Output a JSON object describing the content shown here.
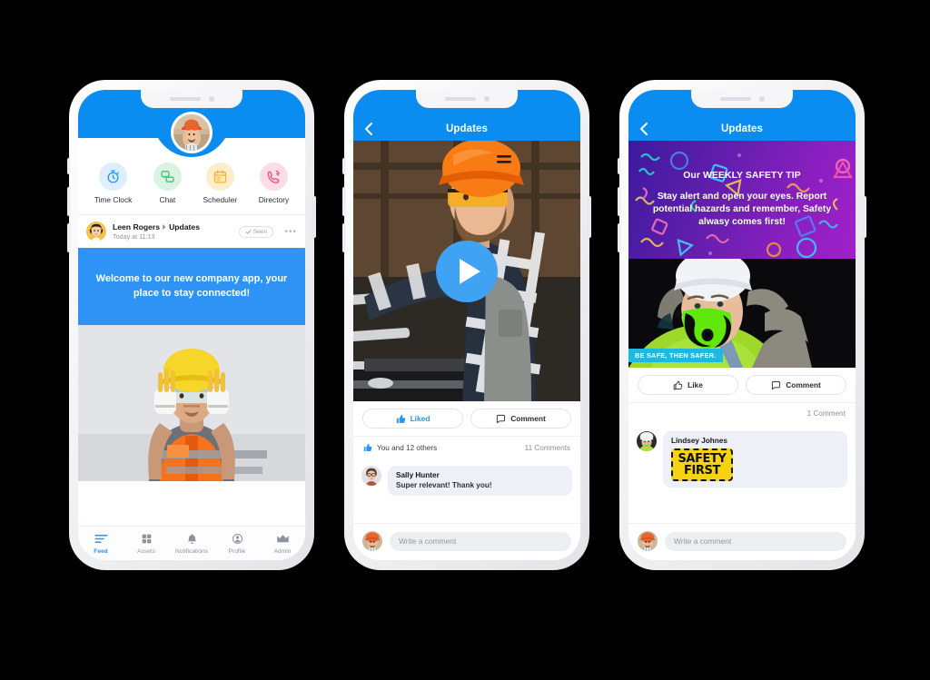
{
  "brand": {
    "blue": "#0a8cf0",
    "banner_blue": "#2f93f5",
    "liked_blue": "#2b95f6"
  },
  "phone1": {
    "header": {
      "avatar_alt": "worker-orange-helmet"
    },
    "quick_actions": [
      {
        "label": "Time Clock",
        "icon": "stopwatch-icon",
        "bubble": "#ddeeff",
        "color": "#2b95f6"
      },
      {
        "label": "Chat",
        "icon": "chat-bubbles-icon",
        "bubble": "#d9f2e2",
        "color": "#4cbf7a"
      },
      {
        "label": "Scheduler",
        "icon": "calendar-icon",
        "bubble": "#fdeecb",
        "color": "#f5b430"
      },
      {
        "label": "Directory",
        "icon": "phone-ring-icon",
        "bubble": "#fcdde6",
        "color": "#f0508a"
      }
    ],
    "post": {
      "author": "Leen Rogers",
      "channel": "Updates",
      "timestamp": "Today at 11:13",
      "seen_label": "Seen",
      "more_label": "•••",
      "banner_text": "Welcome to our new company app, your place to stay connected!"
    },
    "tabs": [
      {
        "label": "Feed",
        "icon": "feed-icon",
        "active": true
      },
      {
        "label": "Assets",
        "icon": "grid-icon",
        "active": false
      },
      {
        "label": "Notifications",
        "icon": "bell-icon",
        "active": false
      },
      {
        "label": "Profile",
        "icon": "person-icon",
        "active": false
      },
      {
        "label": "Admin",
        "icon": "crown-icon",
        "active": false
      }
    ]
  },
  "phone2": {
    "navbar": {
      "title": "Updates",
      "back_icon": "chevron-left-icon"
    },
    "media": {
      "type": "video",
      "alt": "worker-orange-helmet-workshop",
      "play_icon": "play-icon"
    },
    "actions": {
      "like_label": "Liked",
      "like_icon": "thumbs-up-filled-icon",
      "comment_label": "Comment",
      "comment_icon": "comment-bubble-icon"
    },
    "counts": {
      "likes_text": "You and 12 others",
      "likes_icon": "thumbs-up-filled-icon",
      "comments_text": "11 Comments"
    },
    "comment": {
      "author": "Sally Hunter",
      "text": "Super relevant! Thank you!",
      "avatar_alt": "woman-glasses"
    },
    "composer": {
      "placeholder": "Write a comment",
      "value": "",
      "avatar_alt": "worker-orange-helmet"
    }
  },
  "phone3": {
    "navbar": {
      "title": "Updates",
      "back_icon": "chevron-left-icon"
    },
    "tip": {
      "heading": "Our WEEKLY SAFETY TIP",
      "body": "Stay alert and open your eyes. Report potential hazards and remember, Safety alwasy comes first!"
    },
    "media": {
      "alt": "worker-white-helmet-green-mask",
      "caption": "BE SAFE, THEN SAFER."
    },
    "actions": {
      "like_label": "Like",
      "like_icon": "thumbs-up-outline-icon",
      "comment_label": "Comment",
      "comment_icon": "comment-bubble-icon"
    },
    "counts": {
      "comments_text": "1 Comment"
    },
    "comment": {
      "author": "Lindsey Johnes",
      "sticker_line1": "SAFETY",
      "sticker_line2": "FIRST",
      "avatar_alt": "worker-white-helmet"
    },
    "composer": {
      "placeholder": "Write a comment",
      "value": "",
      "avatar_alt": "worker-orange-helmet"
    }
  }
}
